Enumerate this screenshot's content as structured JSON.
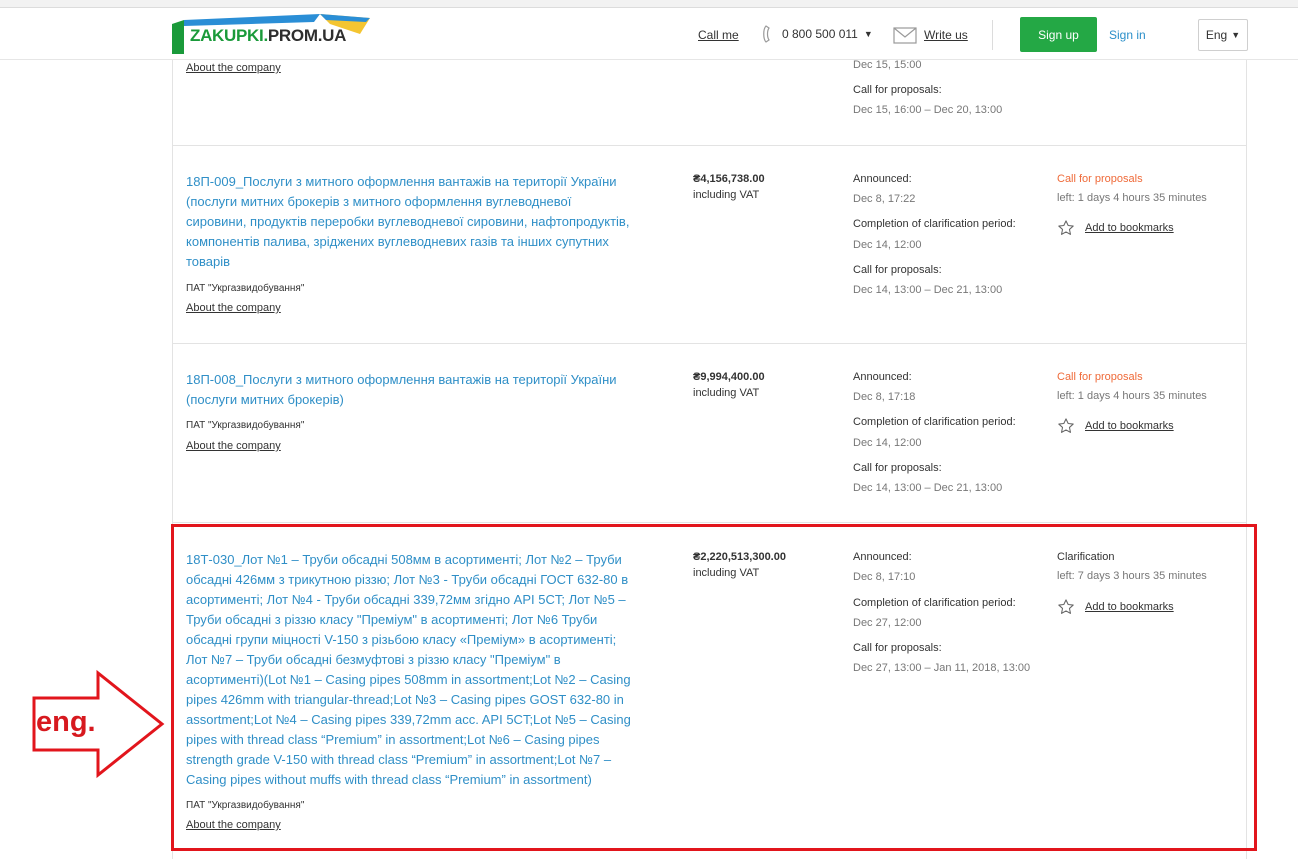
{
  "header": {
    "logo_text_a": "ZAKUPKI.",
    "logo_text_b": "PROM.UA",
    "call_me": "Call me",
    "phone": "0 800 500 011",
    "write_us": "Write us",
    "sign_up": "Sign up",
    "sign_in": "Sign in",
    "lang": "Eng",
    "colors": {
      "green": "#24a845",
      "link": "#2b8fc9"
    }
  },
  "partial": {
    "about": "About the company",
    "date1": "Dec 15, 15:00",
    "call_label": "Call for proposals:",
    "call_range": "Dec 15, 16:00 – Dec 20, 13:00"
  },
  "tenders": [
    {
      "title_lines": [
        "18П-009_Послуги з митного оформлення вантажів на території України",
        "(послуги митних брокерів з митного оформлення вуглеводневої",
        "сировини, продуктів переробки вуглеводневої сировини, нафтопродуктів,",
        "компонентів палива, зріджених вуглеводневих газів та інших супутних",
        "товарів"
      ],
      "org": "ПАТ \"Укргазвидобування\"",
      "about": "About the company",
      "price": "₴4,156,738.00",
      "vat": "including VAT",
      "announced_label": "Announced:",
      "announced": "Dec 8, 17:22",
      "clar_label": "Completion of clarification period:",
      "clar": "Dec 14, 12:00",
      "call_label": "Call for proposals:",
      "call": "Dec 14, 13:00 – Dec 21, 13:00",
      "status": "Call for proposals",
      "left": "left: 1 days 4 hours 35 minutes",
      "bookmark": "Add to bookmarks"
    },
    {
      "title_lines": [
        "18П-008_Послуги з митного оформлення вантажів на території України",
        "(послуги митних брокерів)"
      ],
      "org": "ПАТ \"Укргазвидобування\"",
      "about": "About the company",
      "price": "₴9,994,400.00",
      "vat": "including VAT",
      "announced_label": "Announced:",
      "announced": "Dec 8, 17:18",
      "clar_label": "Completion of clarification period:",
      "clar": "Dec 14, 12:00",
      "call_label": "Call for proposals:",
      "call": "Dec 14, 13:00 – Dec 21, 13:00",
      "status": "Call for proposals",
      "left": "left: 1 days 4 hours 35 minutes",
      "bookmark": "Add to bookmarks"
    },
    {
      "title_lines": [
        "18Т-030_Лот №1 – Труби обсадні 508мм в асортименті; Лот №2 – Труби",
        "обсадні 426мм з трикутною різзю; Лот №3 - Труби обсадні ГОСТ 632-80 в",
        "асортименті; Лот №4 - Труби обсадні 339,72мм згідно API 5CT; Лот №5 –",
        "Труби обсадні з різзю класу \"Преміум\" в асортименті; Лот №6 Труби",
        "обсадні групи міцності V-150 з різьбою класу «Преміум» в асортименті;",
        "Лот №7 – Труби обсадні безмуфтові з різзю класу \"Преміум\" в",
        "асортименті)(Lot №1 – Casing pipes 508mm in assortment;Lot №2 – Casing",
        "pipes 426mm with triangular-thread;Lot №3 – Casing pipes GOST 632-80 in",
        "assortment;Lot №4 – Casing pipes 339,72mm acc. API 5CT;Lot №5 – Casing",
        "pipes with thread class “Premium” in assortment;Lot №6 – Casing pipes",
        "strength grade V-150 with thread class “Premium” in assortment;Lot №7 –",
        "Casing pipes without muffs with thread class “Premium” in assortment)"
      ],
      "org": "ПАТ \"Укргазвидобування\"",
      "about": "About the company",
      "price": "₴2,220,513,300.00",
      "vat": "including VAT",
      "announced_label": "Announced:",
      "announced": "Dec 8, 17:10",
      "clar_label": "Completion of clarification period:",
      "clar": "Dec 27, 12:00",
      "call_label": "Call for proposals:",
      "call": "Dec 27, 13:00 – Jan 11, 2018, 13:00",
      "status": "Clarification",
      "left": "left: 7 days 3 hours 35 minutes",
      "bookmark": "Add to bookmarks"
    }
  ],
  "annotation": {
    "label": "eng.",
    "color": "#e2151c"
  }
}
